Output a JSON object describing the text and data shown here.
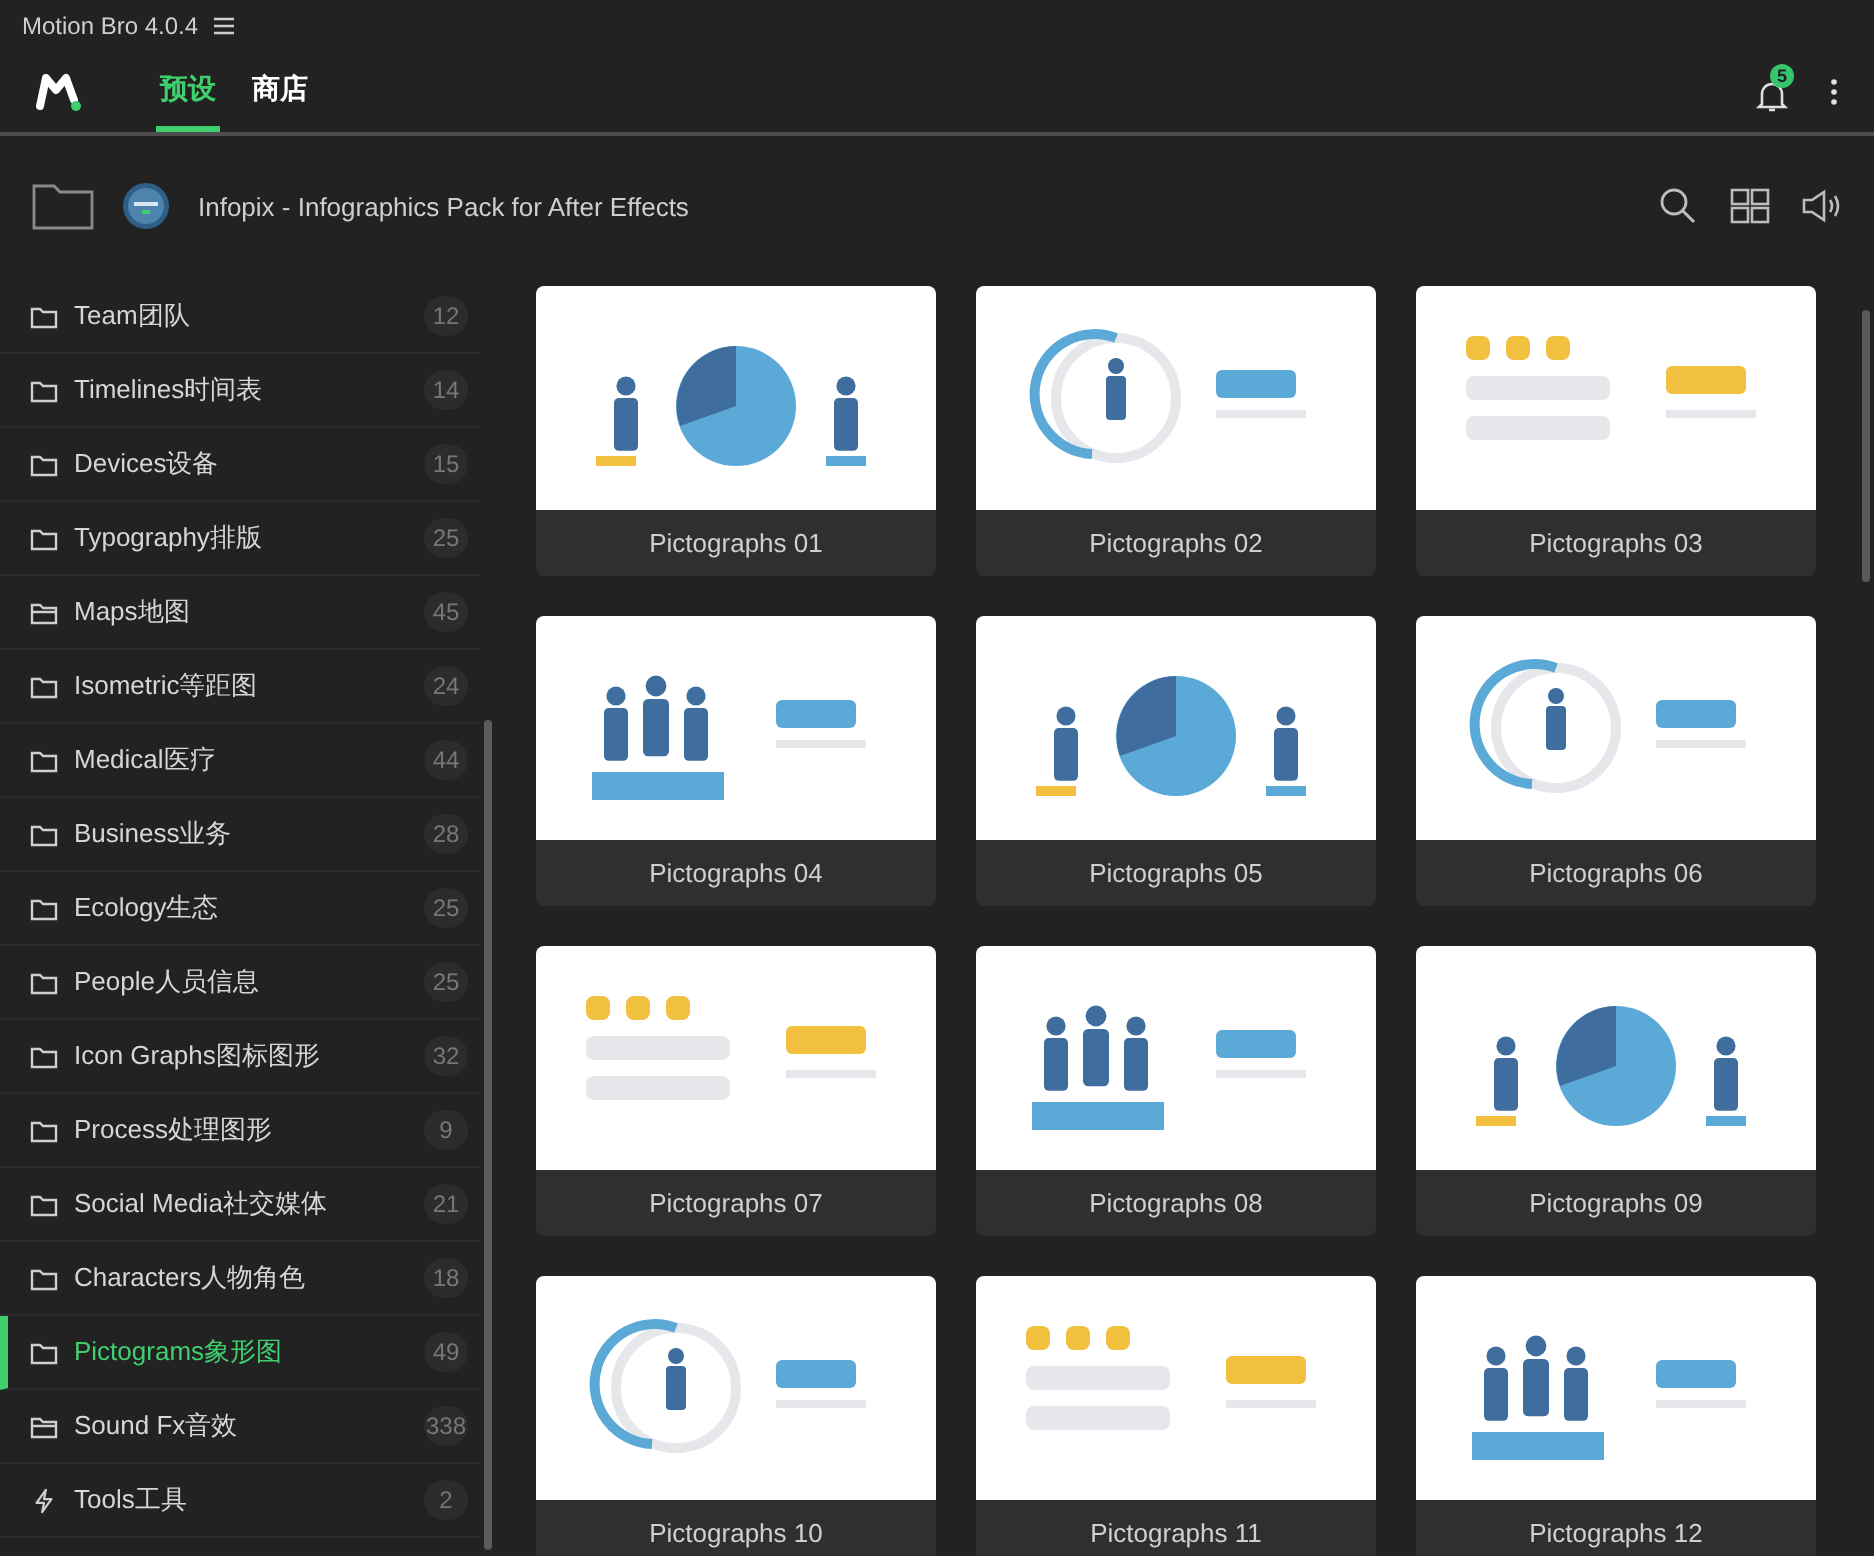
{
  "window": {
    "title": "Motion Bro 4.0.4"
  },
  "tabs": [
    {
      "label": "预设",
      "selected": true
    },
    {
      "label": "商店",
      "selected": false
    }
  ],
  "notifications": {
    "count": "5"
  },
  "pack": {
    "title": "Infopix - Infographics Pack for After Effects"
  },
  "sidebar": {
    "items": [
      {
        "label": "Team团队",
        "count": "12",
        "kind": "folder",
        "selected": false
      },
      {
        "label": "Timelines时间表",
        "count": "14",
        "kind": "folder",
        "selected": false
      },
      {
        "label": "Devices设备",
        "count": "15",
        "kind": "folder",
        "selected": false
      },
      {
        "label": "Typography排版",
        "count": "25",
        "kind": "folder",
        "selected": false
      },
      {
        "label": "Maps地图",
        "count": "45",
        "kind": "folder-open",
        "selected": false
      },
      {
        "label": "Isometric等距图",
        "count": "24",
        "kind": "folder",
        "selected": false
      },
      {
        "label": "Medical医疗",
        "count": "44",
        "kind": "folder",
        "selected": false
      },
      {
        "label": "Business业务",
        "count": "28",
        "kind": "folder",
        "selected": false
      },
      {
        "label": "Ecology生态",
        "count": "25",
        "kind": "folder",
        "selected": false
      },
      {
        "label": "People人员信息",
        "count": "25",
        "kind": "folder",
        "selected": false
      },
      {
        "label": "Icon Graphs图标图形",
        "count": "32",
        "kind": "folder",
        "selected": false
      },
      {
        "label": "Process处理图形",
        "count": "9",
        "kind": "folder",
        "selected": false
      },
      {
        "label": "Social Media社交媒体",
        "count": "21",
        "kind": "folder",
        "selected": false
      },
      {
        "label": "Characters人物角色",
        "count": "18",
        "kind": "folder",
        "selected": false
      },
      {
        "label": "Pictograms象形图",
        "count": "49",
        "kind": "folder",
        "selected": true
      },
      {
        "label": "Sound Fx音效",
        "count": "338",
        "kind": "folder-open",
        "selected": false
      },
      {
        "label": "Tools工具",
        "count": "2",
        "kind": "bolt",
        "selected": false
      }
    ]
  },
  "presets": [
    {
      "title": "Pictographs 01"
    },
    {
      "title": "Pictographs 02"
    },
    {
      "title": "Pictographs 03"
    },
    {
      "title": "Pictographs 04"
    },
    {
      "title": "Pictographs 05"
    },
    {
      "title": "Pictographs 06"
    },
    {
      "title": "Pictographs 07"
    },
    {
      "title": "Pictographs 08"
    },
    {
      "title": "Pictographs 09"
    },
    {
      "title": "Pictographs 10"
    },
    {
      "title": "Pictographs 11"
    },
    {
      "title": "Pictographs 12"
    }
  ]
}
